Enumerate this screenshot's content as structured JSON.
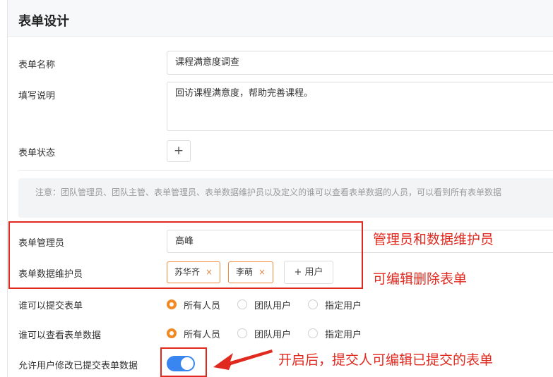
{
  "header": {
    "title": "表单设计"
  },
  "form": {
    "name_label": "表单名称",
    "name_value": "课程满意度调查",
    "desc_label": "填写说明",
    "desc_value": "回访课程满意度，帮助完善课程。",
    "status_label": "表单状态",
    "status_add": "+",
    "notice": "注意：团队管理员、团队主管、表单管理员、表单数据维护员以及定义的谁可以查看表单数据的人员，可以看到所有表单数据",
    "admin_label": "表单管理员",
    "admin_value": "高峰",
    "maintainer_label": "表单数据维护员",
    "maintainers": [
      "苏华齐",
      "李萌"
    ],
    "tag_remove": "×",
    "add_user_label": "+ 用户",
    "submit_label": "谁可以提交表单",
    "view_label": "谁可以查看表单数据",
    "radio_options": [
      "所有人员",
      "团队用户",
      "指定用户"
    ],
    "submit_selected": "所有人员",
    "view_selected": "所有人员",
    "edit_label": "允许用户修改已提交表单数据",
    "edit_enabled": true
  },
  "annotations": {
    "roles": "管理员和数据维护员",
    "can_edit": "可编辑删除表单",
    "toggle_note": "开启后，提交人可编辑已提交的表单"
  },
  "colors": {
    "accent": "#f08a24",
    "toggle": "#3a86f0",
    "annotation": "#e0291f"
  }
}
